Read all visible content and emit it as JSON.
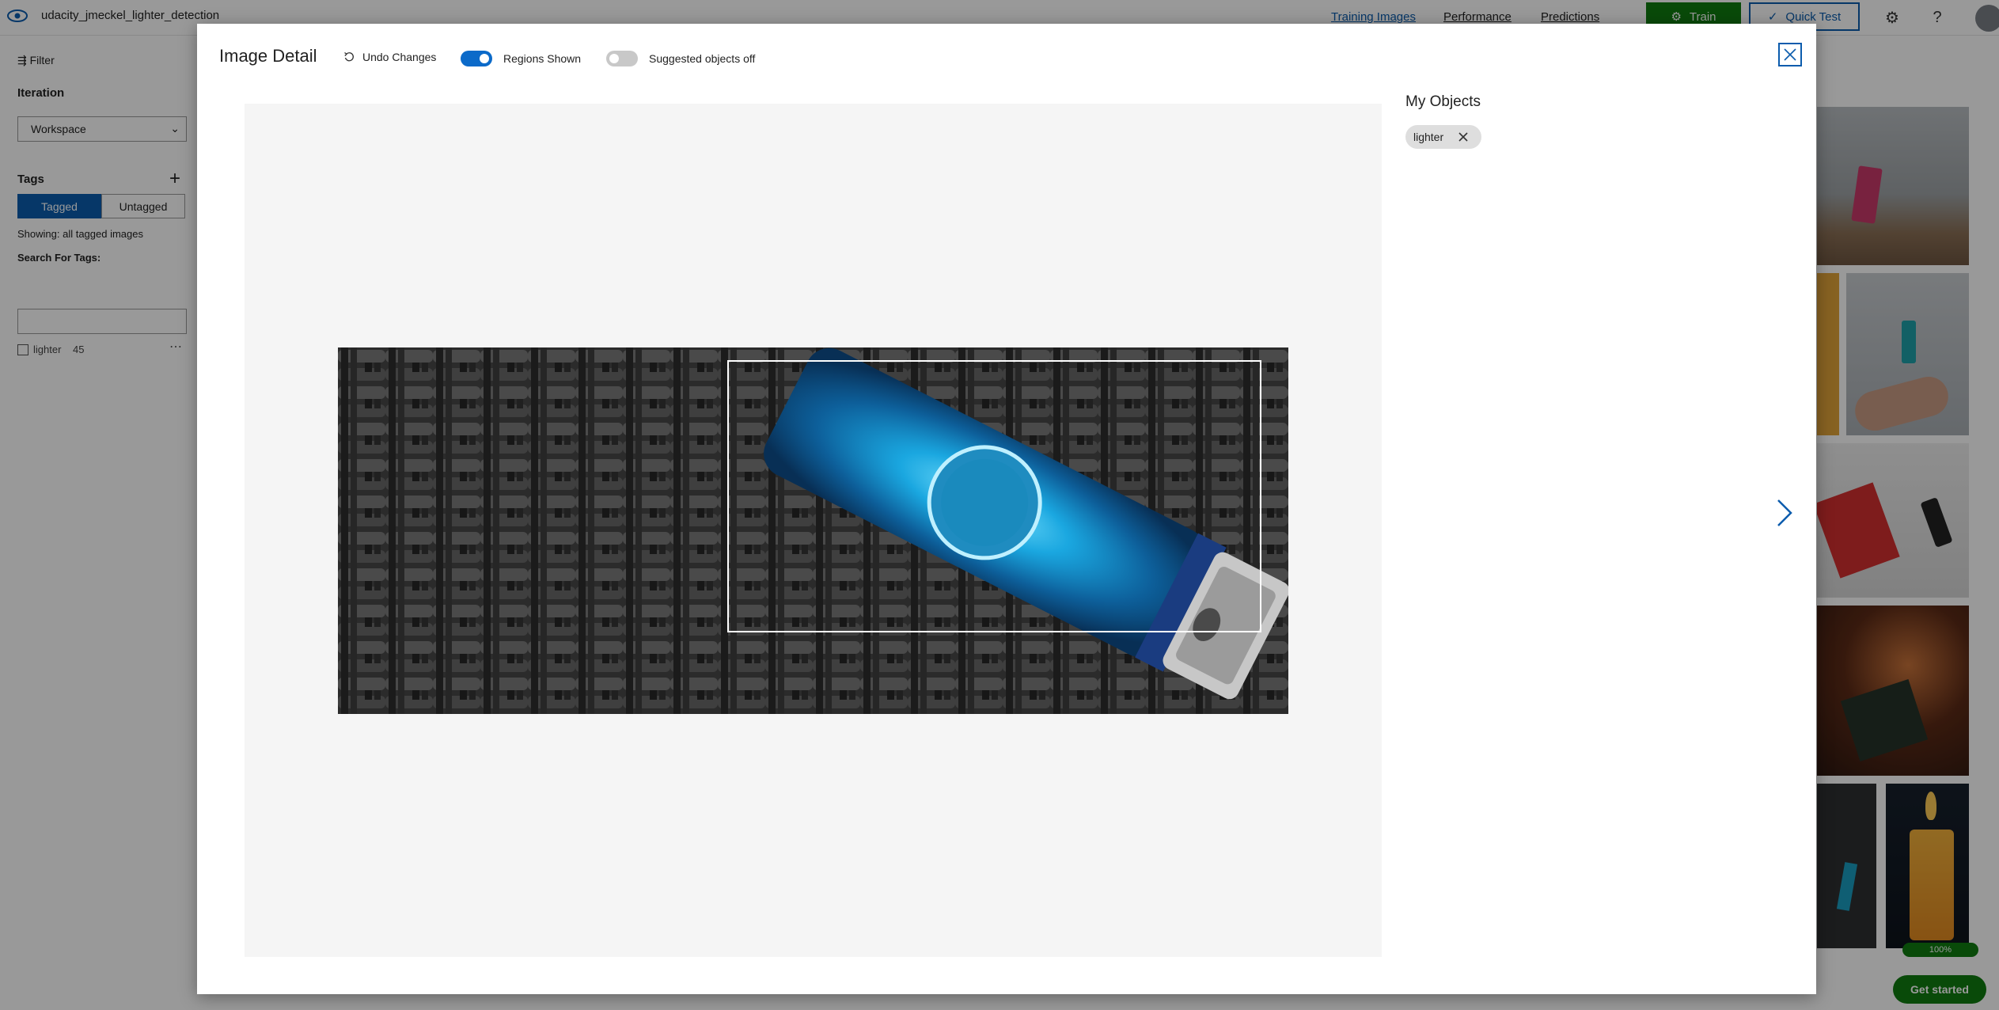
{
  "app": {
    "project_name": "udacity_jmeckel_lighter_detection"
  },
  "nav": {
    "training_images": "Training Images",
    "performance": "Performance",
    "predictions": "Predictions",
    "train": "Train",
    "quick_test": "Quick Test"
  },
  "sidebar": {
    "filter": "Filter",
    "iteration_heading": "Iteration",
    "iteration_value": "Workspace",
    "tags_heading": "Tags",
    "tagged": "Tagged",
    "untagged": "Untagged",
    "showing": "Showing: all tagged images",
    "search_label": "Search For Tags:",
    "search_value": "",
    "tag_items": [
      {
        "name": "lighter",
        "count": "45"
      }
    ]
  },
  "footer": {
    "progress": "100%",
    "get_started": "Get started"
  },
  "modal": {
    "title": "Image Detail",
    "undo": "Undo Changes",
    "regions_label": "Regions Shown",
    "regions_on": true,
    "suggested_label": "Suggested objects off",
    "suggested_on": false,
    "objects_heading": "My Objects",
    "objects": [
      {
        "label": "lighter"
      }
    ]
  },
  "colors": {
    "accent": "#0b5cad",
    "train_green": "#107c10",
    "toggle_blue": "#0b6ac9"
  },
  "icons": [
    "eye-logo-icon",
    "filter-icon",
    "plus-icon",
    "undo-icon",
    "close-icon",
    "chevron-right-icon",
    "gear-icon",
    "help-icon",
    "checkmark-icon",
    "train-gears-icon"
  ]
}
